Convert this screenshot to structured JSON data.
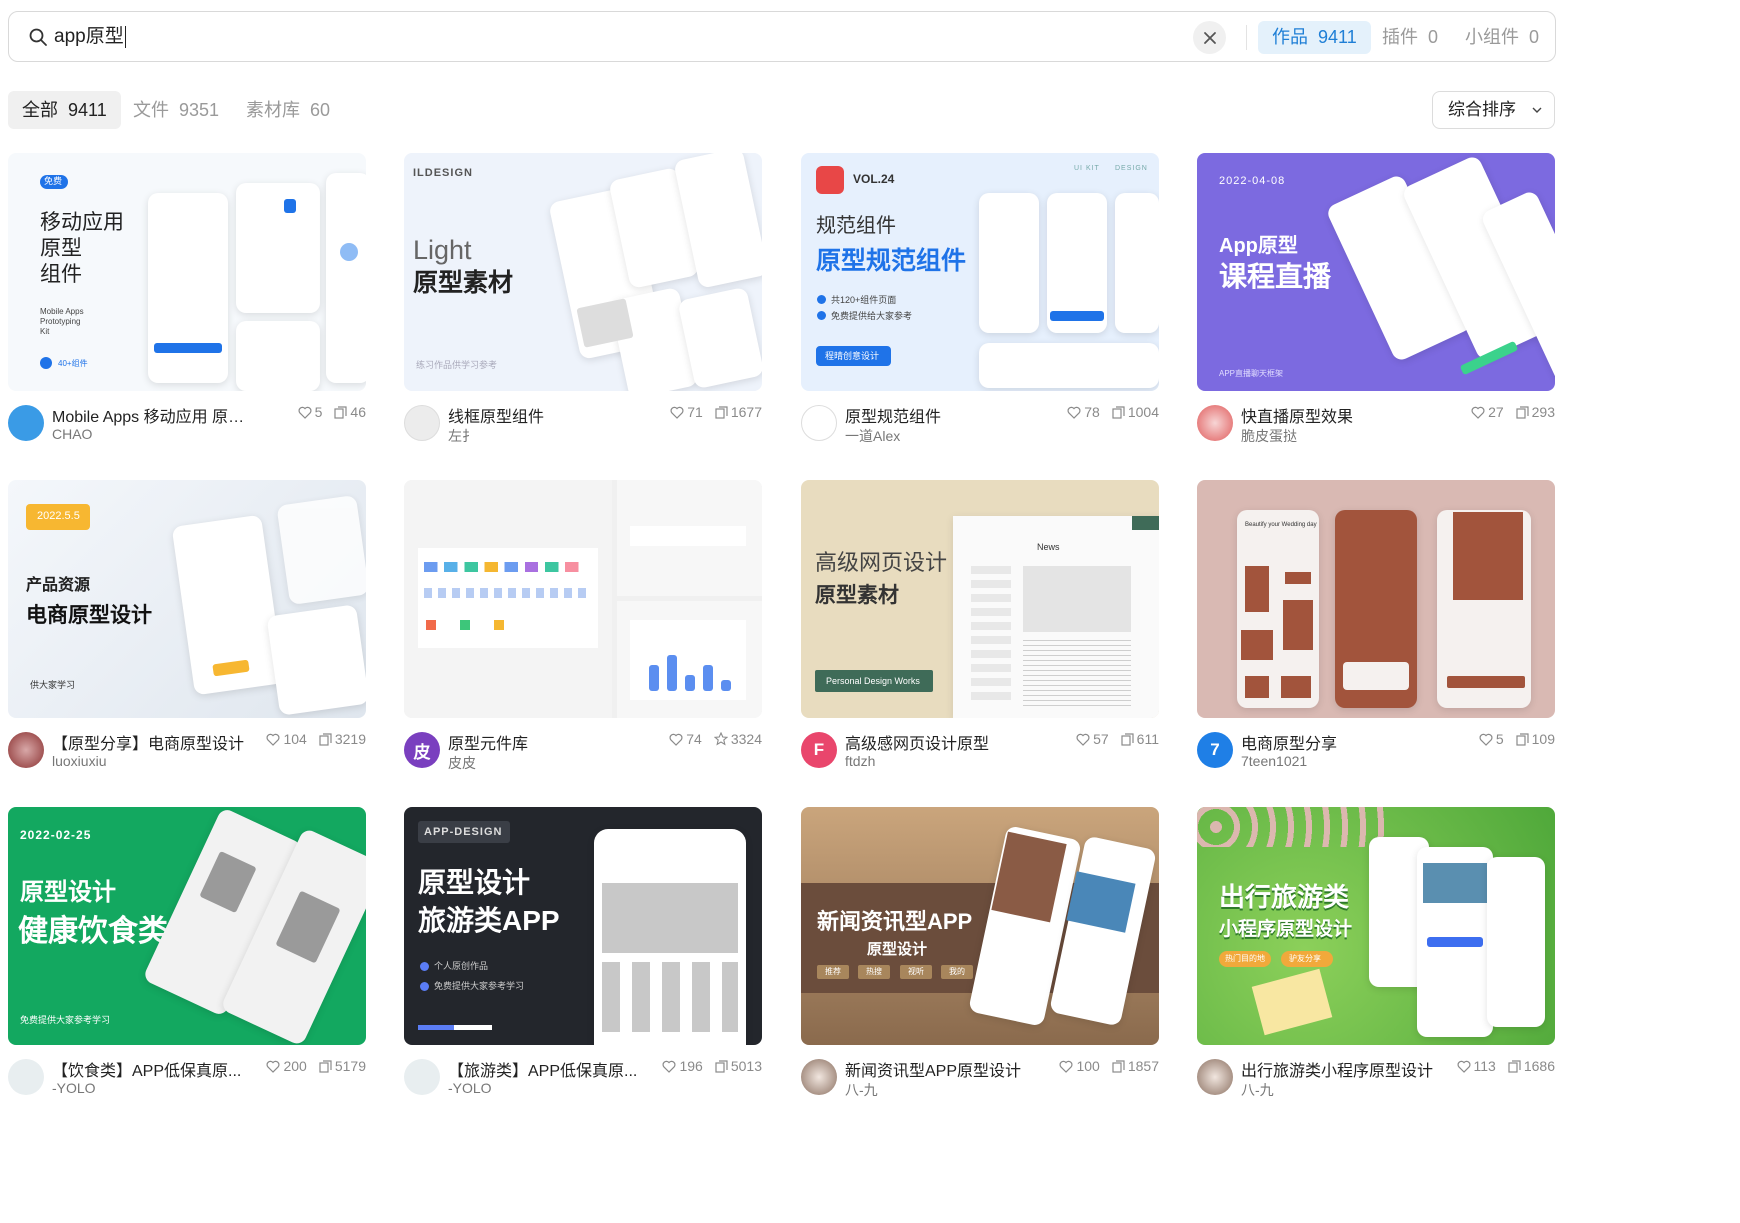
{
  "search": {
    "query": "app原型",
    "clear_icon": "close-icon"
  },
  "scope_tabs": [
    {
      "label": "作品",
      "count": "9411"
    },
    {
      "label": "插件",
      "count": "0"
    },
    {
      "label": "小组件",
      "count": "0"
    }
  ],
  "filter_tabs": [
    {
      "label": "全部",
      "count": "9411"
    },
    {
      "label": "文件",
      "count": "9351"
    },
    {
      "label": "素材库",
      "count": "60"
    }
  ],
  "sort": {
    "label": "综合排序"
  },
  "colors": {
    "accent": "#1f7fd6",
    "accent_bg": "#e4f1fb"
  },
  "cards": [
    {
      "title": "Mobile Apps 移动应用 原型 组...",
      "author": "CHAO",
      "likes": "5",
      "second_stat": "46",
      "second_icon": "copy-icon",
      "thumb": {
        "tag": "免费",
        "line1": "移动应用",
        "line2": "原型",
        "line3": "组件",
        "sub1": "Mobile Apps",
        "sub2": "Prototyping",
        "sub3": "Kit",
        "badge": "40+组件"
      }
    },
    {
      "title": "线框原型组件",
      "author": "左扌",
      "likes": "71",
      "second_stat": "1677",
      "second_icon": "copy-icon",
      "thumb": {
        "brand": "ILDESIGN",
        "line1": "Light",
        "line2": "原型素材",
        "foot": "练习作品供学习参考"
      }
    },
    {
      "title": "原型规范组件",
      "author": "一道Alex",
      "likes": "78",
      "second_stat": "1004",
      "second_icon": "copy-icon",
      "thumb": {
        "vol": "VOL.24",
        "kit1": "UI KIT",
        "kit2": "DESIGN",
        "line1": "规范组件",
        "line2": "原型规范组件",
        "check1": "共120+组件页面",
        "check2": "免费提供给大家参考",
        "button": "程晴创意设计"
      }
    },
    {
      "title": "快直播原型效果",
      "author": "脆皮蛋挞",
      "likes": "27",
      "second_stat": "293",
      "second_icon": "copy-icon",
      "thumb": {
        "date": "2022-04-08",
        "line1": "App原型",
        "line2": "课程直播",
        "foot": "APP直播聊天框架"
      }
    },
    {
      "title": "【原型分享】电商原型设计",
      "author": "luoxiuxiu",
      "likes": "104",
      "second_stat": "3219",
      "second_icon": "copy-icon",
      "thumb": {
        "date": "2022.5.5",
        "line1": "产品资源",
        "line2": "电商原型设计",
        "foot": "供大家学习"
      }
    },
    {
      "title": "原型元件库",
      "author": "皮皮",
      "likes": "74",
      "second_stat": "3324",
      "second_icon": "star-icon",
      "avatar_text": "皮",
      "thumb": {}
    },
    {
      "title": "高级感网页设计原型",
      "author": "ftdzh",
      "likes": "57",
      "second_stat": "611",
      "second_icon": "copy-icon",
      "avatar_text": "F",
      "thumb": {
        "line1": "高级网页设计",
        "line2": "原型素材",
        "button": "Personal Design Works",
        "news": "News"
      }
    },
    {
      "title": "电商原型分享",
      "author": "7teen1021",
      "likes": "5",
      "second_stat": "109",
      "second_icon": "copy-icon",
      "avatar_text": "7",
      "thumb": {
        "small": "Beautify your Wedding day"
      }
    },
    {
      "title": "【饮食类】APP低保真原...",
      "author": "-YOLO",
      "likes": "200",
      "second_stat": "5179",
      "second_icon": "copy-icon",
      "thumb": {
        "date": "2022-02-25",
        "line1": "原型设计",
        "line2": "健康饮食类",
        "foot": "免费提供大家参考学习"
      }
    },
    {
      "title": "【旅游类】APP低保真原...",
      "author": "-YOLO",
      "likes": "196",
      "second_stat": "5013",
      "second_icon": "copy-icon",
      "thumb": {
        "tag": "APP-DESIGN",
        "line1": "原型设计",
        "line2": "旅游类APP",
        "check1": "个人原创作品",
        "check2": "免费提供大家参考学习"
      }
    },
    {
      "title": "新闻资讯型APP原型设计",
      "author": "八-九",
      "likes": "100",
      "second_stat": "1857",
      "second_icon": "copy-icon",
      "thumb": {
        "line1": "新闻资讯型APP",
        "line2": "原型设计",
        "chips": [
          "推荐",
          "热搜",
          "视听",
          "我的"
        ]
      }
    },
    {
      "title": "出行旅游类小程序原型设计",
      "author": "八-九",
      "likes": "113",
      "second_stat": "1686",
      "second_icon": "copy-icon",
      "thumb": {
        "line1": "出行旅游类",
        "line2": "小程序原型设计",
        "chip1": "热门目的地",
        "chip2": "驴友分享"
      }
    }
  ]
}
